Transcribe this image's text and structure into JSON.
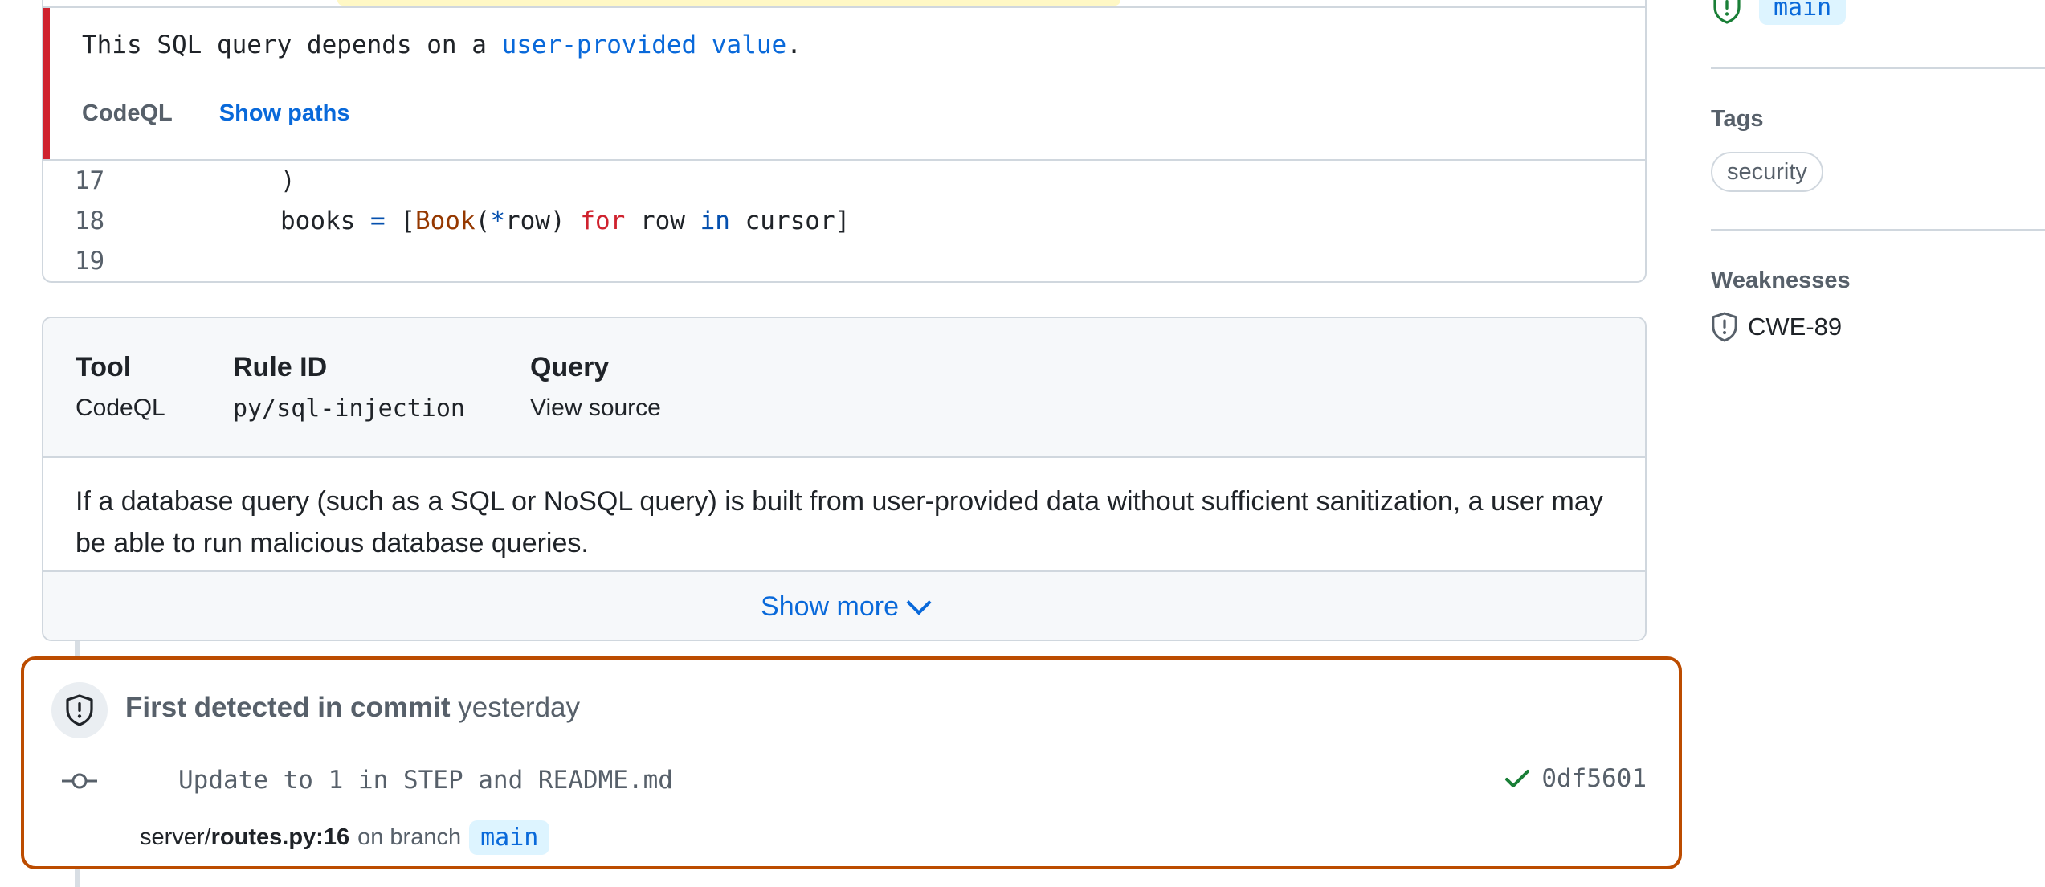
{
  "alert": {
    "message_prefix": "This SQL query depends on a ",
    "message_link": "user-provided value",
    "message_suffix": ".",
    "tool": "CodeQL",
    "show_paths": "Show paths"
  },
  "code_lines": [
    {
      "number": "17",
      "text": ")"
    },
    {
      "number": "18",
      "text": "books = [Book(*row) for row in cursor]"
    },
    {
      "number": "19",
      "text": ""
    }
  ],
  "info": {
    "tool_label": "Tool",
    "tool_value": "CodeQL",
    "rule_label": "Rule ID",
    "rule_value": "py/sql-injection",
    "query_label": "Query",
    "query_value": "View source",
    "description": "If a database query (such as a SQL or NoSQL query) is built from user-provided data without sufficient sanitization, a user may be able to run malicious database queries.",
    "show_more": "Show more"
  },
  "detection": {
    "title_bold": "First detected in commit",
    "title_time": "yesterday",
    "commit_message": "Update to 1 in STEP and README.md",
    "commit_sha": "0df5601",
    "path_dir": "server/",
    "path_file": "routes.py:16",
    "on_branch": "on branch",
    "branch": "main"
  },
  "sidebar": {
    "branch": "main",
    "tags_label": "Tags",
    "tag": "security",
    "weaknesses_label": "Weaknesses",
    "weakness": "CWE-89"
  },
  "colors": {
    "danger": "#cf222e",
    "accent": "#0969da",
    "highlight_border": "#bc4c00",
    "success": "#1a7f37"
  }
}
